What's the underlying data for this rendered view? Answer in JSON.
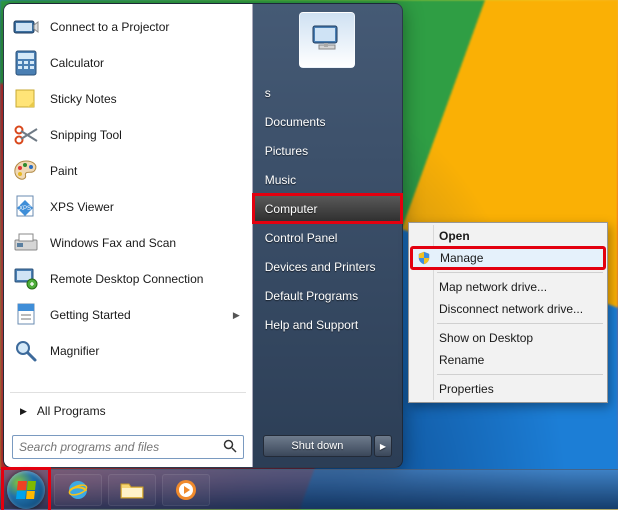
{
  "programs": [
    {
      "id": "projector",
      "label": "Connect to a Projector",
      "icon": "projector"
    },
    {
      "id": "calculator",
      "label": "Calculator",
      "icon": "calculator"
    },
    {
      "id": "sticky",
      "label": "Sticky Notes",
      "icon": "sticky-notes"
    },
    {
      "id": "snip",
      "label": "Snipping Tool",
      "icon": "scissors"
    },
    {
      "id": "paint",
      "label": "Paint",
      "icon": "palette"
    },
    {
      "id": "xps",
      "label": "XPS Viewer",
      "icon": "xps"
    },
    {
      "id": "faxscan",
      "label": "Windows Fax and Scan",
      "icon": "fax"
    },
    {
      "id": "rdp",
      "label": "Remote Desktop Connection",
      "icon": "remote-desktop"
    },
    {
      "id": "getting",
      "label": "Getting Started",
      "icon": "getting-started",
      "has_submenu": true
    },
    {
      "id": "magnifier",
      "label": "Magnifier",
      "icon": "magnifier"
    }
  ],
  "all_programs_label": "All Programs",
  "search_placeholder": "Search programs and files",
  "right_links": [
    {
      "id": "user",
      "label": "s"
    },
    {
      "id": "documents",
      "label": "Documents"
    },
    {
      "id": "pictures",
      "label": "Pictures"
    },
    {
      "id": "music",
      "label": "Music"
    },
    {
      "id": "computer",
      "label": "Computer",
      "highlighted": true
    },
    {
      "id": "controlpanel",
      "label": "Control Panel"
    },
    {
      "id": "devices",
      "label": "Devices and Printers"
    },
    {
      "id": "defaults",
      "label": "Default Programs"
    },
    {
      "id": "help",
      "label": "Help and Support"
    }
  ],
  "shutdown_label": "Shut down",
  "context_menu": {
    "items": [
      {
        "id": "open",
        "label": "Open"
      },
      {
        "id": "manage",
        "label": "Manage",
        "highlighted": true,
        "icon": "shield"
      },
      {
        "sep": true
      },
      {
        "id": "mapdrive",
        "label": "Map network drive..."
      },
      {
        "id": "disconnect",
        "label": "Disconnect network drive..."
      },
      {
        "sep": true
      },
      {
        "id": "showdesktop",
        "label": "Show on Desktop"
      },
      {
        "id": "rename",
        "label": "Rename"
      },
      {
        "sep": true
      },
      {
        "id": "properties",
        "label": "Properties"
      }
    ]
  }
}
